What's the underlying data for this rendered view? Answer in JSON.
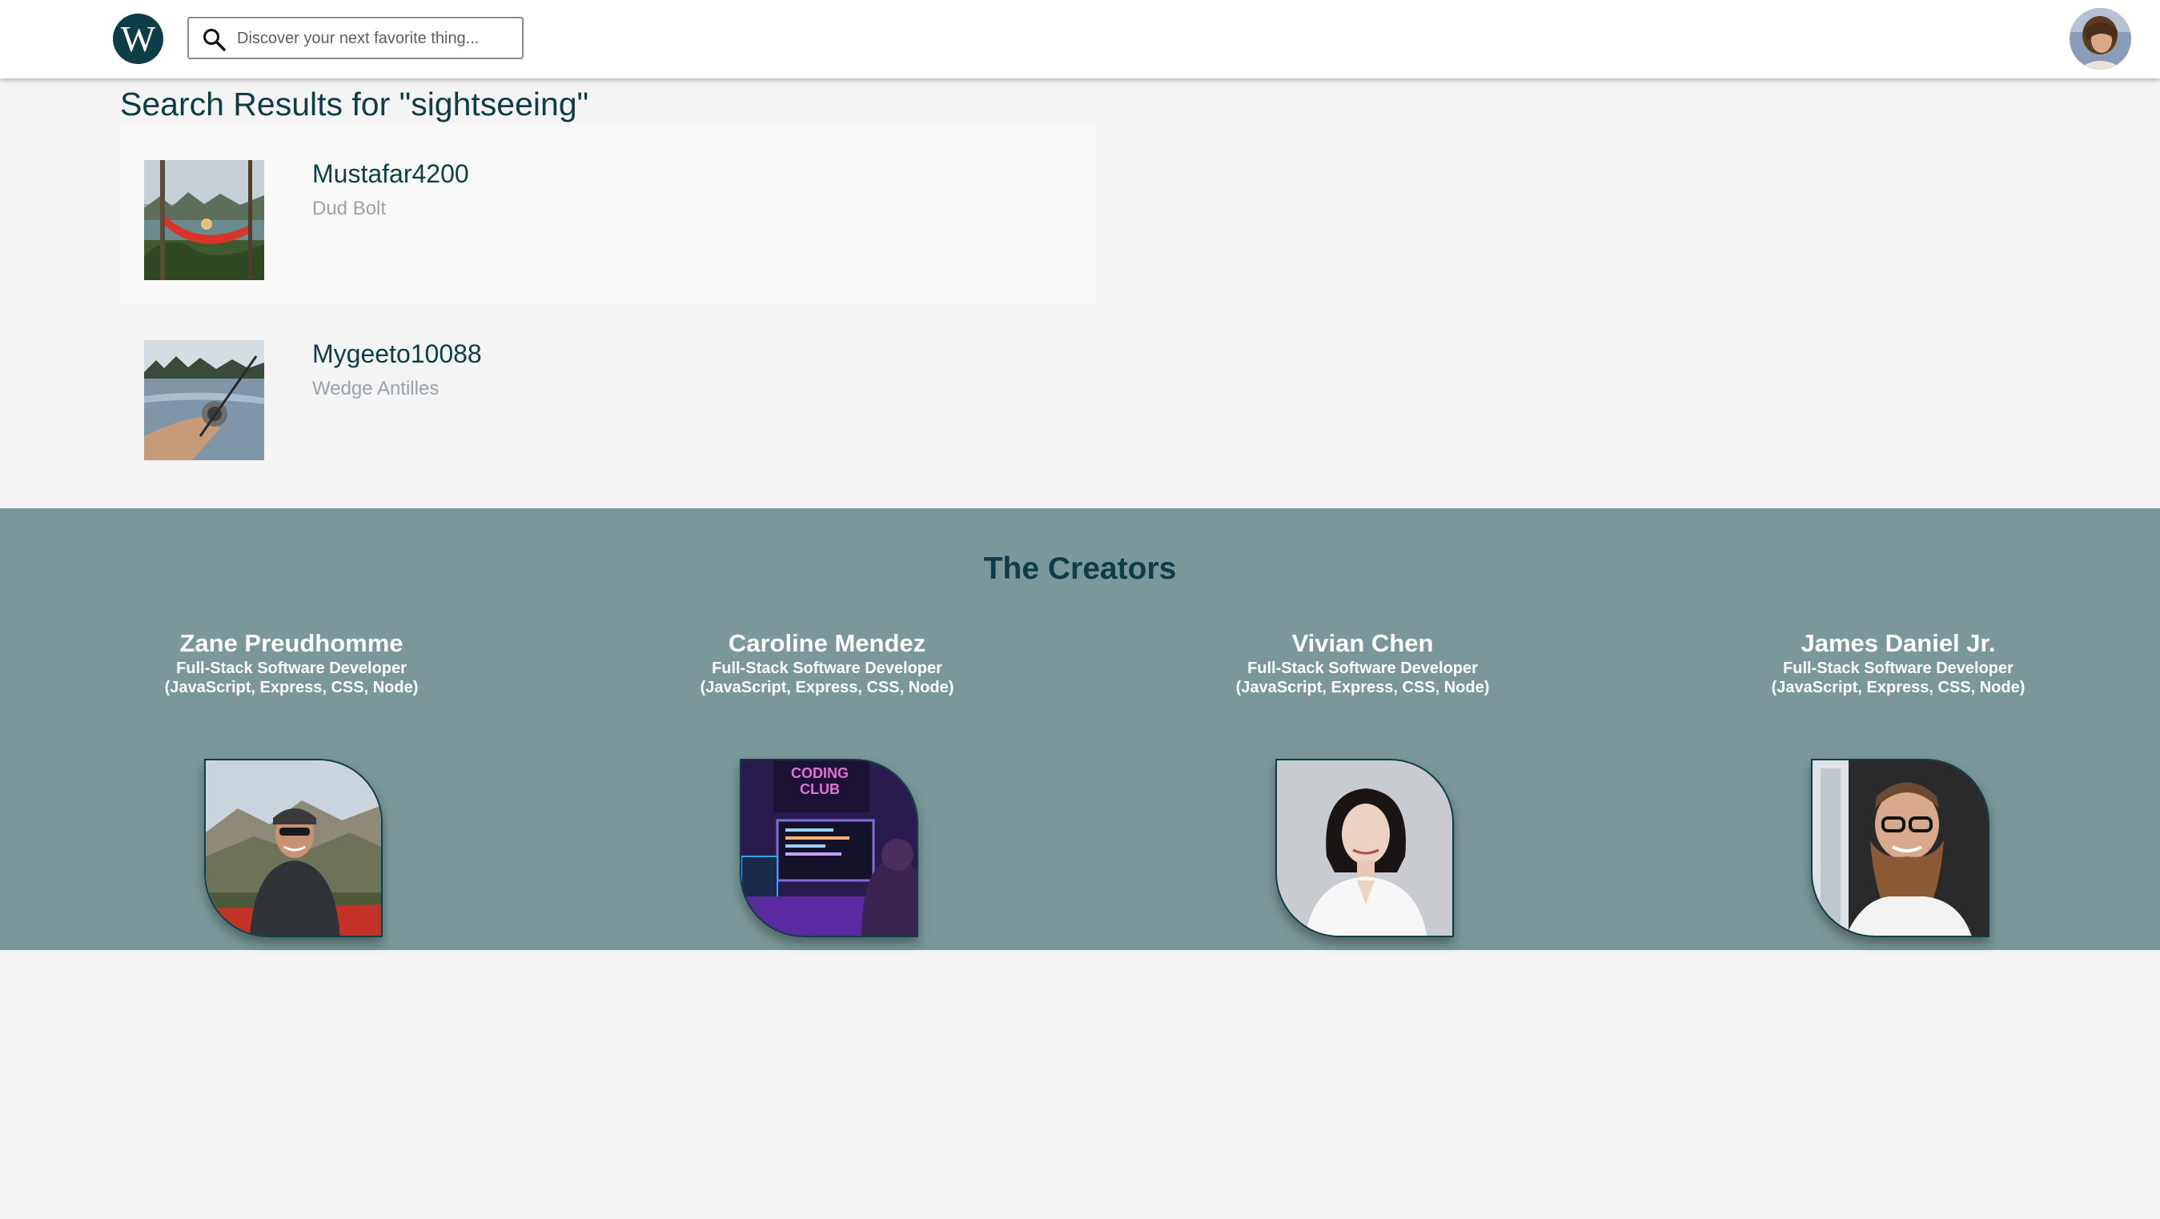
{
  "header": {
    "logo_letter": "W",
    "search_placeholder": "Discover your next favorite thing..."
  },
  "results": {
    "title": "Search Results for \"sightseeing\"",
    "items": [
      {
        "name": "Mustafar4200",
        "subtitle": "Dud Bolt"
      },
      {
        "name": "Mygeeto10088",
        "subtitle": "Wedge Antilles"
      }
    ]
  },
  "creators": {
    "title": "The Creators",
    "people": [
      {
        "name": "Zane Preudhomme",
        "role_line1": "Full-Stack Software Developer",
        "role_line2": "(JavaScript, Express, CSS, Node)"
      },
      {
        "name": "Caroline Mendez",
        "role_line1": "Full-Stack Software Developer",
        "role_line2": "(JavaScript, Express, CSS, Node)",
        "photo_sign_line1": "CODING",
        "photo_sign_line2": "CLUB"
      },
      {
        "name": "Vivian Chen",
        "role_line1": "Full-Stack Software Developer",
        "role_line2": "(JavaScript, Express, CSS, Node)"
      },
      {
        "name": "James Daniel Jr.",
        "role_line1": "Full-Stack Software Developer",
        "role_line2": "(JavaScript, Express, CSS, Node)"
      }
    ]
  },
  "colors": {
    "brand_dark_teal": "#0d3d47",
    "creators_background": "#7a9899",
    "page_background": "#f4f4f4",
    "muted_text": "#9aa3ad"
  },
  "icons": [
    "logo-icon",
    "search-icon",
    "user-avatar-icon"
  ]
}
